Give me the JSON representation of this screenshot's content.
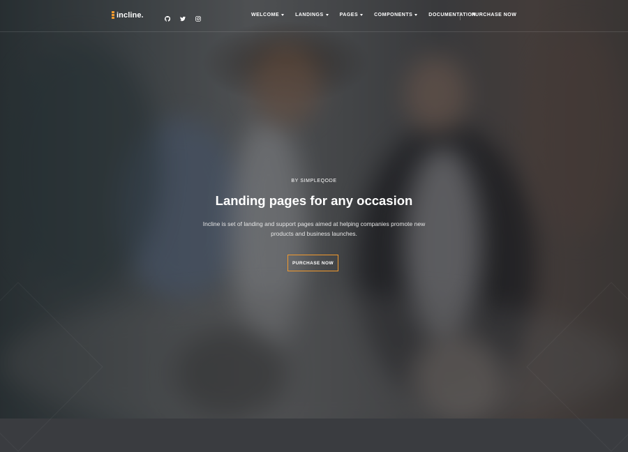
{
  "brand": {
    "name": "incline.",
    "accent": "#f29a2e"
  },
  "socials": [
    {
      "icon": "github-icon"
    },
    {
      "icon": "twitter-icon"
    },
    {
      "icon": "instagram-icon"
    }
  ],
  "nav": {
    "items": [
      {
        "label": "WELCOME",
        "has_dropdown": true
      },
      {
        "label": "LANDINGS",
        "has_dropdown": true
      },
      {
        "label": "PAGES",
        "has_dropdown": true
      },
      {
        "label": "COMPONENTS",
        "has_dropdown": true
      },
      {
        "label": "DOCUMENTATION",
        "has_dropdown": false
      }
    ],
    "purchase_label": "PURCHASE NOW"
  },
  "hero": {
    "kicker": "BY SIMPLEQODE",
    "title": "Landing pages for any occasion",
    "description": "Incline is set of landing and support pages aimed at helping companies promote new products and business launches.",
    "cta_label": "PURCHASE NOW"
  }
}
